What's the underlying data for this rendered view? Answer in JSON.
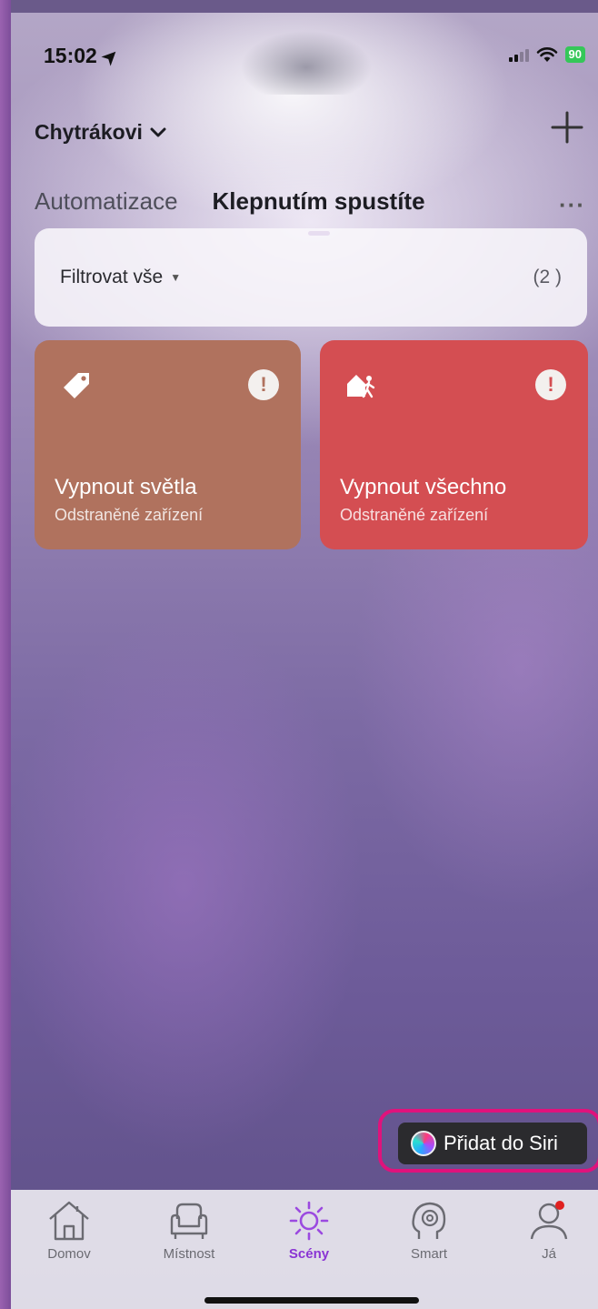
{
  "status_bar": {
    "time": "15:02",
    "battery": "90"
  },
  "header": {
    "home_name": "Chytrákovi",
    "add_icon": "plus-icon",
    "more_icon": "ellipsis-icon"
  },
  "tabs": [
    {
      "label": "Automatizace",
      "active": false
    },
    {
      "label": "Klepnutím spustíte",
      "active": true
    }
  ],
  "filter": {
    "label": "Filtrovat vše",
    "count": "(2 )"
  },
  "scenes": [
    {
      "name": "Vypnout světla",
      "subtitle": "Odstraněné zařízení",
      "icon": "tag-icon",
      "color": "#b0725e"
    },
    {
      "name": "Vypnout všechno",
      "subtitle": "Odstraněné zařízení",
      "icon": "leave-home-icon",
      "color": "#d44e52"
    }
  ],
  "siri_button": {
    "label": "Přidat do Siri"
  },
  "tab_bar": [
    {
      "label": "Domov",
      "icon": "home-icon",
      "active": false
    },
    {
      "label": "Místnost",
      "icon": "armchair-icon",
      "active": false
    },
    {
      "label": "Scény",
      "icon": "sun-icon",
      "active": true
    },
    {
      "label": "Smart",
      "icon": "brain-icon",
      "active": false
    },
    {
      "label": "Já",
      "icon": "person-icon",
      "active": false
    }
  ],
  "colors": {
    "accent": "#8a35d4",
    "tab_indicator": "#6c2fa0",
    "siri_highlight": "#e0127c"
  }
}
